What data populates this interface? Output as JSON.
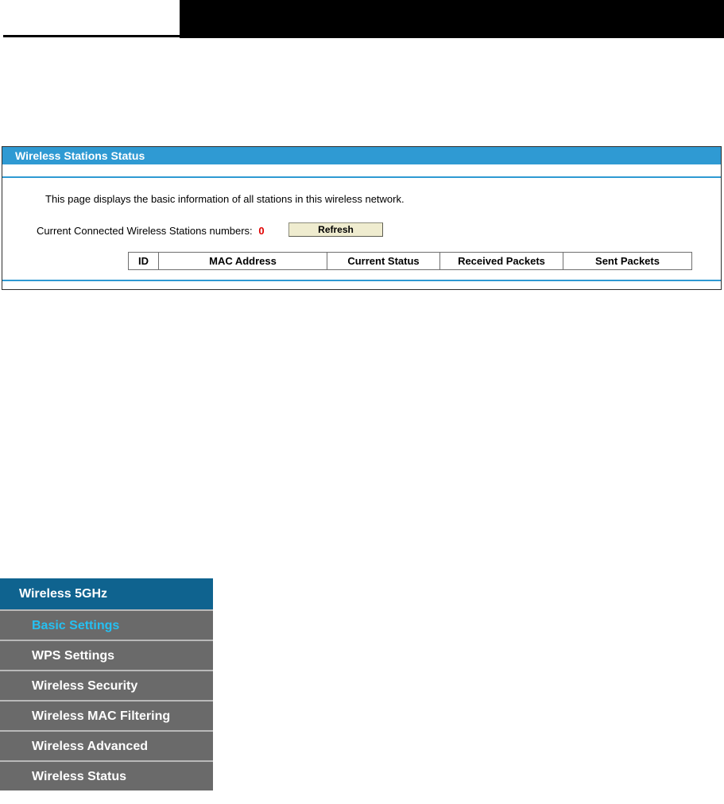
{
  "panel": {
    "title": "Wireless Stations Status",
    "description": "This page displays the basic information of all stations in this wireless network.",
    "stations_label": "Current Connected Wireless Stations numbers:",
    "stations_count": "0",
    "refresh_label": "Refresh",
    "table_headers": [
      "ID",
      "MAC Address",
      "Current Status",
      "Received Packets",
      "Sent Packets"
    ]
  },
  "menu": {
    "header": "Wireless 5GHz",
    "items": [
      {
        "label": "Basic Settings",
        "active": true
      },
      {
        "label": "WPS Settings",
        "active": false
      },
      {
        "label": "Wireless Security",
        "active": false
      },
      {
        "label": "Wireless MAC Filtering",
        "active": false
      },
      {
        "label": "Wireless Advanced",
        "active": false
      },
      {
        "label": "Wireless Status",
        "active": false
      }
    ]
  },
  "colors": {
    "panel_accent": "#2f9ad3",
    "menu_header": "#0f638f",
    "menu_item_bg": "#6a6a6a",
    "active_item": "#25c0f2",
    "count_red": "#e00000"
  }
}
